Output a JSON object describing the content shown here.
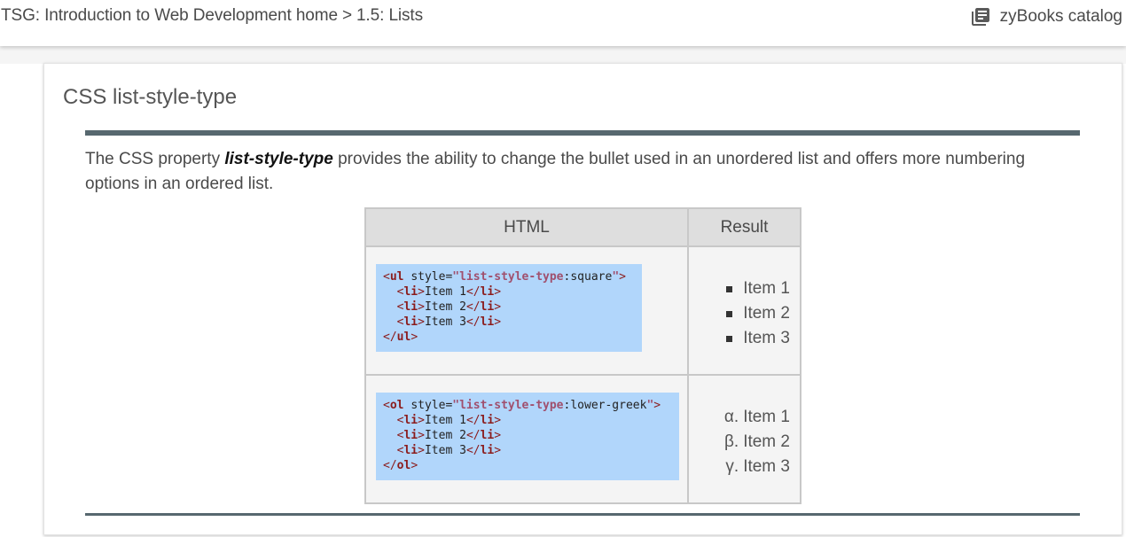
{
  "header": {
    "breadcrumb_home": "TSG: Introduction to Web Development home",
    "breadcrumb_sep": ">",
    "breadcrumb_current": "1.5: Lists",
    "catalog_label": "zyBooks catalog",
    "catalog_icon": "library-books-icon"
  },
  "card": {
    "title": "CSS list-style-type",
    "desc_before": "The CSS property ",
    "desc_keyword": "list-style-type",
    "desc_after": " provides the ability to change the bullet used in an unordered list and offers more numbering options in an ordered list."
  },
  "table": {
    "col_html": "HTML",
    "col_result": "Result",
    "rows": [
      {
        "tag": "ul",
        "attr": "style",
        "prop": "list-style-type",
        "value": "square",
        "items": [
          "Item 1",
          "Item 2",
          "Item 3"
        ],
        "markers": [
          "",
          "",
          ""
        ]
      },
      {
        "tag": "ol",
        "attr": "style",
        "prop": "list-style-type",
        "value": "lower-greek",
        "items": [
          "Item 1",
          "Item 2",
          "Item 3"
        ],
        "markers": [
          "α.",
          "β.",
          "γ."
        ]
      }
    ]
  }
}
